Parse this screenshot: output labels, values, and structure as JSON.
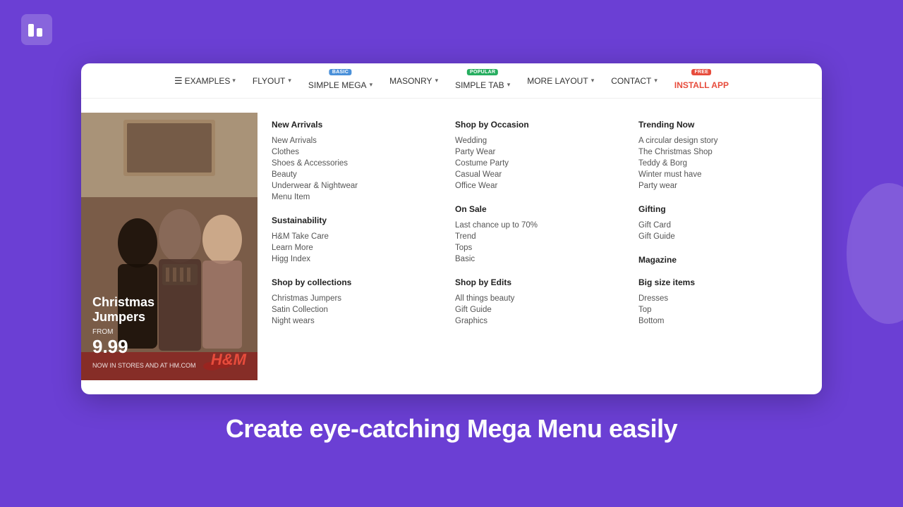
{
  "logo": {
    "alt": "App logo"
  },
  "nav": {
    "items": [
      {
        "label": "EXAMPLES",
        "has_dropdown": true,
        "has_hamburger": true,
        "badge": null
      },
      {
        "label": "FLYOUT",
        "has_dropdown": true,
        "badge": null
      },
      {
        "label": "SIMPLE MEGA",
        "has_dropdown": true,
        "badge": {
          "text": "BASIC",
          "type": "blue"
        }
      },
      {
        "label": "MASONRY",
        "has_dropdown": true,
        "badge": null
      },
      {
        "label": "SIMPLE TAB",
        "has_dropdown": true,
        "badge": {
          "text": "POPULAR",
          "type": "green"
        }
      },
      {
        "label": "MORE LAYOUT",
        "has_dropdown": true,
        "badge": null,
        "active": true
      },
      {
        "label": "CONTACT",
        "has_dropdown": true,
        "badge": null
      },
      {
        "label": "INSTALL APP",
        "has_dropdown": false,
        "badge": {
          "text": "FREE",
          "type": "red"
        },
        "special": true
      }
    ]
  },
  "menu_image": {
    "promo_title": "Christmas\nJumpers",
    "promo_from": "FROM",
    "promo_price": "9.99",
    "promo_subtitle": "NOW IN STORES AND AT HM.COM",
    "brand_logo": "H&M"
  },
  "menu_col1": {
    "sections": [
      {
        "title": "New Arrivals",
        "links": [
          "New Arrivals",
          "Clothes",
          "Shoes & Accessories",
          "Beauty",
          "Underwear & Nightwear",
          "Menu Item"
        ]
      },
      {
        "title": "Sustainability",
        "links": [
          "H&M Take Care",
          "Learn More",
          "Higg Index"
        ]
      },
      {
        "title": "Shop by collections",
        "links": [
          "Christmas Jumpers",
          "Satin Collection",
          "Night wears"
        ]
      }
    ]
  },
  "menu_col2": {
    "sections": [
      {
        "title": "Shop by Occasion",
        "links": [
          "Wedding",
          "Party Wear",
          "Costume Party",
          "Casual Wear",
          "Office Wear"
        ]
      },
      {
        "title": "On Sale",
        "links": [
          "Last chance up to 70%",
          "Trend",
          "Tops",
          "Basic"
        ]
      },
      {
        "title": "Shop by Edits",
        "links": [
          "All things beauty",
          "Gift Guide",
          "Graphics"
        ]
      }
    ]
  },
  "menu_col3": {
    "sections": [
      {
        "title": "Trending Now",
        "links": [
          "A circular design story",
          "The Christmas Shop",
          "Teddy & Borg",
          "Winter must have",
          "Party wear"
        ]
      },
      {
        "title": "Gifting",
        "links": [
          "Gift Card",
          "Gift Guide"
        ]
      },
      {
        "title": "Magazine",
        "links": []
      },
      {
        "title": "Big size items",
        "links": [
          "Dresses",
          "Top",
          "Bottom"
        ]
      }
    ]
  },
  "bottom_headline": "Create eye-catching Mega Menu easily"
}
